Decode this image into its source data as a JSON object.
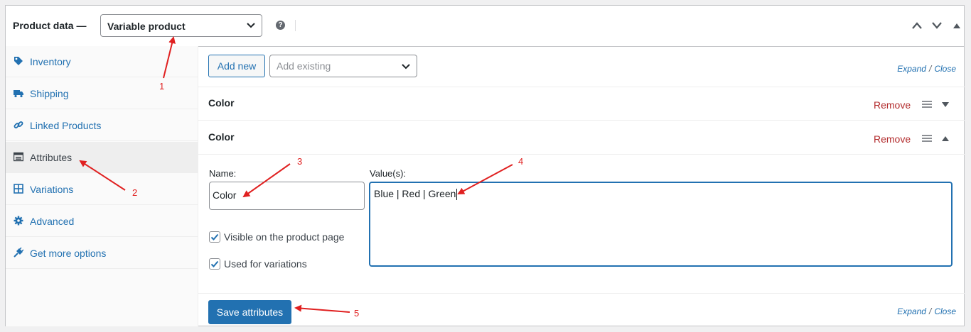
{
  "header": {
    "label": "Product data —",
    "product_type": "Variable product",
    "help_icon": "help-icon",
    "controls": [
      "chevron-up-icon",
      "chevron-down-icon",
      "collapse-triangle-icon"
    ]
  },
  "sidebar": {
    "items": [
      {
        "label": "Inventory",
        "icon": "tag-icon"
      },
      {
        "label": "Shipping",
        "icon": "truck-icon"
      },
      {
        "label": "Linked Products",
        "icon": "link-icon"
      },
      {
        "label": "Attributes",
        "icon": "list-icon",
        "active": true
      },
      {
        "label": "Variations",
        "icon": "grid-icon"
      },
      {
        "label": "Advanced",
        "icon": "gear-icon"
      },
      {
        "label": "Get more options",
        "icon": "plugin-icon"
      }
    ]
  },
  "toolbar": {
    "add_new": "Add new",
    "add_existing_placeholder": "Add existing",
    "expand": "Expand",
    "close": "Close",
    "separator": "/"
  },
  "attributes": [
    {
      "name": "Color",
      "remove": "Remove",
      "expanded": false
    },
    {
      "name": "Color",
      "remove": "Remove",
      "expanded": true
    }
  ],
  "form": {
    "name_label": "Name:",
    "name_value": "Color",
    "values_label": "Value(s):",
    "values_value": "Blue | Red | Green",
    "visible_label": "Visible on the product page",
    "visible_checked": true,
    "variations_label": "Used for variations",
    "variations_checked": true
  },
  "footer": {
    "save": "Save attributes",
    "expand": "Expand",
    "close": "Close",
    "separator": "/"
  },
  "annotations": [
    "1",
    "2",
    "3",
    "4",
    "5"
  ],
  "colors": {
    "accent": "#2271b1",
    "remove": "#b32d2e",
    "annotation": "#e02020"
  }
}
